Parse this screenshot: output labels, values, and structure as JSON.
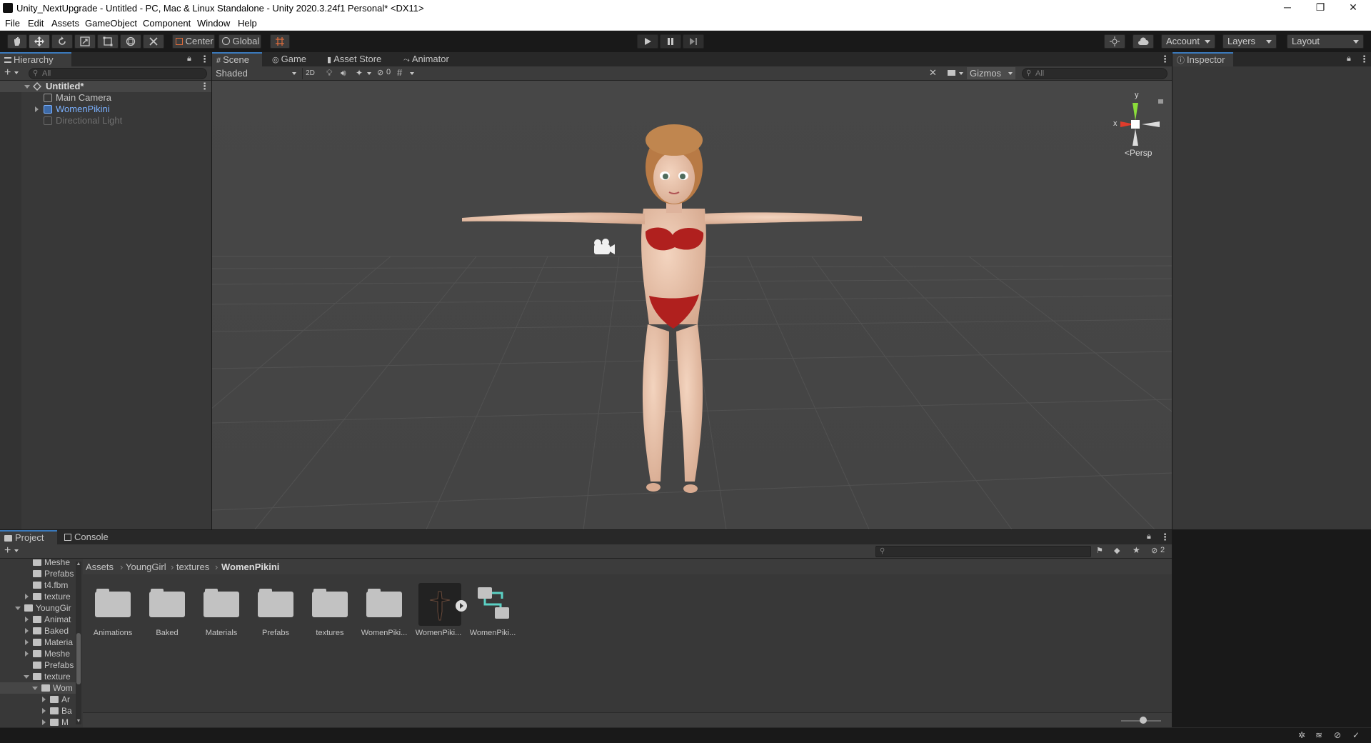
{
  "window": {
    "title": "Unity_NextUpgrade - Untitled - PC, Mac & Linux Standalone - Unity 2020.3.24f1 Personal* <DX11>",
    "minimize": "─",
    "restore": "❐",
    "close": "✕"
  },
  "menu": [
    "File",
    "Edit",
    "Assets",
    "GameObject",
    "Component",
    "Window",
    "Help"
  ],
  "toolbar": {
    "tools": [
      "hand-tool",
      "move-tool",
      "rotate-tool",
      "scale-tool",
      "rect-tool",
      "transform-tool",
      "custom-tool"
    ],
    "pivot": "Center",
    "space": "Global",
    "account": "Account",
    "layers": "Layers",
    "layout": "Layout"
  },
  "hierarchy": {
    "tab": "Hierarchy",
    "search_placeholder": "All",
    "scene": "Untitled*",
    "items": [
      {
        "name": "Main Camera",
        "style": "normal"
      },
      {
        "name": "WomenPikini",
        "style": "prefab"
      },
      {
        "name": "Directional Light",
        "style": "disabled"
      }
    ]
  },
  "scene_view": {
    "tabs": [
      "Scene",
      "Game",
      "Asset Store",
      "Animator"
    ],
    "draw_mode": "Shaded",
    "mode_2d": "2D",
    "hidden_count": "0",
    "gizmos": "Gizmos",
    "search_placeholder": "All",
    "axis_y": "y",
    "axis_x": "x",
    "projection": "Persp"
  },
  "inspector": {
    "tab": "Inspector"
  },
  "project": {
    "tabs": [
      "Project",
      "Console"
    ],
    "hidden_count": "2",
    "breadcrumb": [
      "Assets",
      "YoungGirl",
      "textures",
      "WomenPikini"
    ],
    "tree": [
      {
        "label": "Meshe",
        "indent": 2,
        "type": "folder",
        "expand": "none"
      },
      {
        "label": "Prefabs",
        "indent": 2,
        "type": "folder",
        "expand": "none"
      },
      {
        "label": "t4.fbm",
        "indent": 2,
        "type": "folder",
        "expand": "none"
      },
      {
        "label": "texture",
        "indent": 2,
        "type": "folder",
        "expand": "right"
      },
      {
        "label": "YoungGir",
        "indent": 1,
        "type": "folder",
        "expand": "down"
      },
      {
        "label": "Animat",
        "indent": 2,
        "type": "folder",
        "expand": "right"
      },
      {
        "label": "Baked",
        "indent": 2,
        "type": "folder",
        "expand": "right"
      },
      {
        "label": "Materia",
        "indent": 2,
        "type": "folder",
        "expand": "right"
      },
      {
        "label": "Meshe",
        "indent": 2,
        "type": "folder",
        "expand": "right"
      },
      {
        "label": "Prefabs",
        "indent": 2,
        "type": "folder",
        "expand": "none"
      },
      {
        "label": "texture",
        "indent": 2,
        "type": "folder",
        "expand": "down"
      },
      {
        "label": "Wom",
        "indent": 3,
        "type": "folder",
        "expand": "down"
      },
      {
        "label": "Ar",
        "indent": 4,
        "type": "folder",
        "expand": "right"
      },
      {
        "label": "Ba",
        "indent": 4,
        "type": "folder",
        "expand": "right"
      },
      {
        "label": "M",
        "indent": 4,
        "type": "folder",
        "expand": "right"
      }
    ],
    "assets": [
      {
        "label": "Animations",
        "type": "folder"
      },
      {
        "label": "Baked",
        "type": "folder"
      },
      {
        "label": "Materials",
        "type": "folder"
      },
      {
        "label": "Prefabs",
        "type": "folder"
      },
      {
        "label": "textures",
        "type": "folder"
      },
      {
        "label": "WomenPiki...",
        "type": "folder"
      },
      {
        "label": "WomenPiki...",
        "type": "model"
      },
      {
        "label": "WomenPiki...",
        "type": "controller"
      }
    ]
  },
  "colors": {
    "accent": "#3a79bb",
    "prefab": "#7bb1ff",
    "disabled": "#6f6f6f",
    "scene_bg": "#464646",
    "panel_bg": "#383838"
  }
}
